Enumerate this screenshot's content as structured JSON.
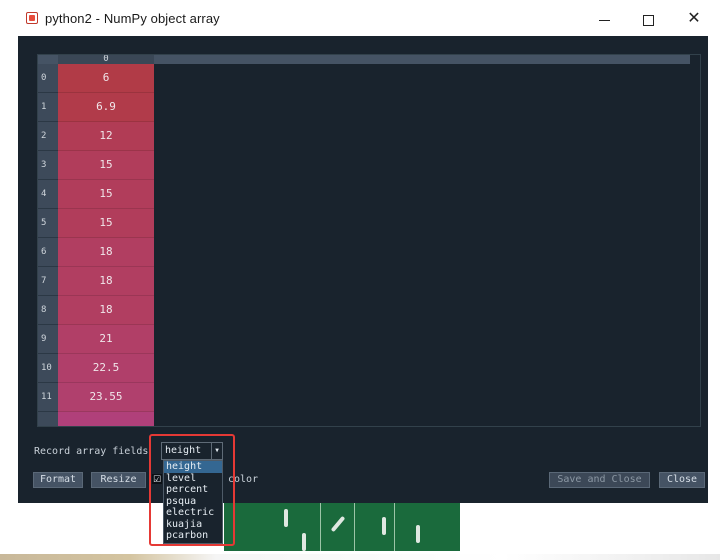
{
  "window": {
    "title": "python2 - NumPy object array",
    "app_icon": "spyder-icon",
    "controls": {
      "minimize": "minimize-icon",
      "maximize": "maximize-icon",
      "close_glyph": "✕"
    }
  },
  "table": {
    "column_header": "0",
    "rows": [
      {
        "index": "0",
        "value": "6",
        "color": "#b13b47"
      },
      {
        "index": "1",
        "value": "6.9",
        "color": "#b13b4a"
      },
      {
        "index": "2",
        "value": "12",
        "color": "#b13c55"
      },
      {
        "index": "3",
        "value": "15",
        "color": "#b13d5b"
      },
      {
        "index": "4",
        "value": "15",
        "color": "#b13d5b"
      },
      {
        "index": "5",
        "value": "15",
        "color": "#b13d5b"
      },
      {
        "index": "6",
        "value": "18",
        "color": "#b13e61"
      },
      {
        "index": "7",
        "value": "18",
        "color": "#b13e61"
      },
      {
        "index": "8",
        "value": "18",
        "color": "#b13e61"
      },
      {
        "index": "9",
        "value": "21",
        "color": "#b13f67"
      },
      {
        "index": "10",
        "value": "22.5",
        "color": "#b03f6a"
      },
      {
        "index": "11",
        "value": "23.55",
        "color": "#b0406d"
      }
    ],
    "partial_row_color": "#b0407a"
  },
  "controls": {
    "record_fields_label": "Record array fields",
    "record_fields_value": "height",
    "format_label": "Format",
    "resize_label": "Resize",
    "background_color_label": "color",
    "background_color_checked": "☑",
    "save_close_label": "Save and Close",
    "close_label": "Close"
  },
  "dropdown": {
    "options": [
      "height",
      "level",
      "percent",
      "psqua",
      "electric",
      "kuajia",
      "pcarbon"
    ],
    "selected": "height"
  },
  "colors": {
    "window_bg": "#19232d",
    "header_bg": "#455364",
    "selection": "#346792",
    "highlight_box": "#e53935"
  }
}
